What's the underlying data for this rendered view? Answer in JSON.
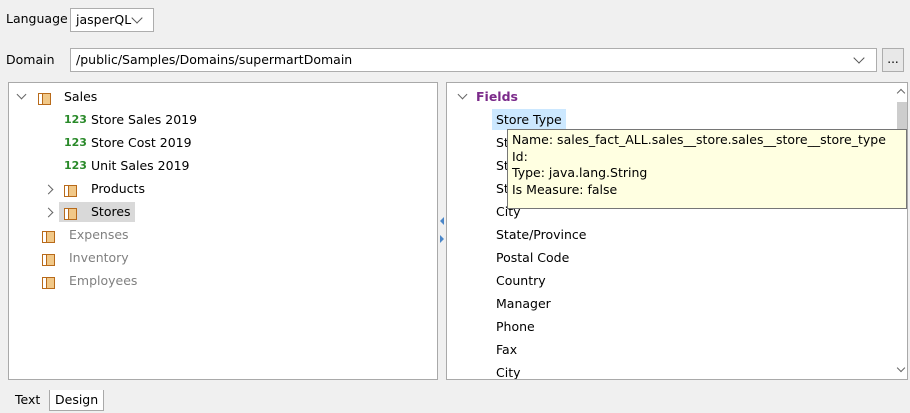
{
  "language": {
    "label": "Language",
    "value": "jasperQL"
  },
  "domain": {
    "label": "Domain",
    "value": "/public/Samples/Domains/supermartDomain",
    "browse_label": "..."
  },
  "tree": {
    "sales": {
      "label": "Sales",
      "measures": [
        {
          "badge": "123",
          "label": "Store Sales 2019"
        },
        {
          "badge": "123",
          "label": "Store Cost 2019"
        },
        {
          "badge": "123",
          "label": "Unit Sales 2019"
        }
      ],
      "groups": [
        {
          "label": "Products"
        },
        {
          "label": "Stores"
        }
      ]
    },
    "other": [
      {
        "label": "Expenses"
      },
      {
        "label": "Inventory"
      },
      {
        "label": "Employees"
      }
    ]
  },
  "fields": {
    "header": "Fields",
    "items": [
      "Store Type",
      "St",
      "St",
      "St",
      "City",
      "State/Province",
      "Postal Code",
      "Country",
      "Manager",
      "Phone",
      "Fax",
      "City"
    ]
  },
  "tooltip": {
    "name": "Name: sales_fact_ALL.sales__store.sales__store__store_type",
    "id": "Id:",
    "type": "Type: java.lang.String",
    "measure": "Is Measure: false"
  },
  "tabs": [
    "Text",
    "Design"
  ],
  "colors": {
    "fields_header": "#7b2a8a",
    "measure_badge": "#2a8a2a",
    "splitter_arrow": "#4a86c8",
    "selection": "#cce8ff"
  }
}
